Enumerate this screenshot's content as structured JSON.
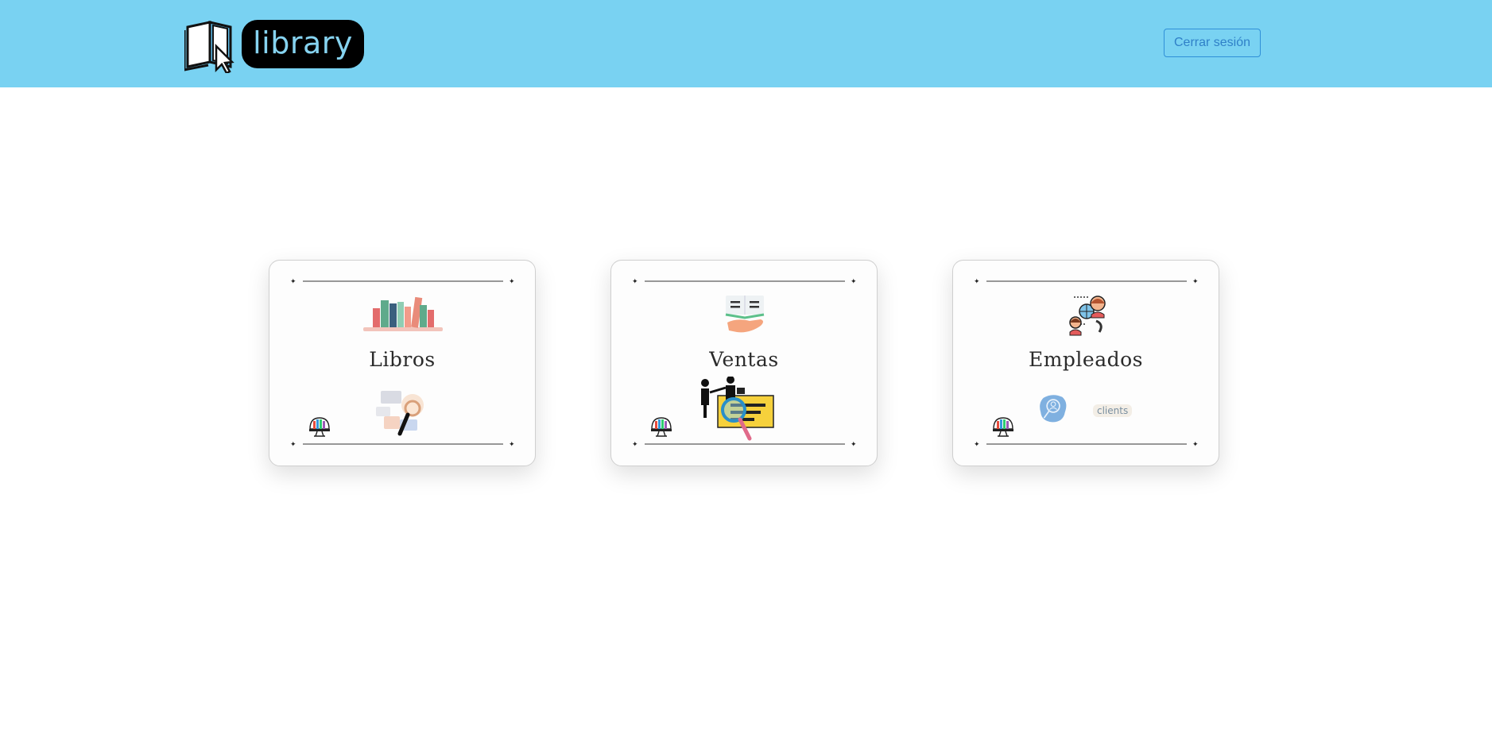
{
  "header": {
    "logo_text": "library",
    "logout_label": "Cerrar sesión",
    "background_color": "#79d2f2",
    "logout_color": "#2f80c8"
  },
  "cards": [
    {
      "title": "Libros",
      "top_icon": "books-shelf-icon",
      "bottom_icon": "book-search-icon",
      "corner_icon": "library-computer-icon"
    },
    {
      "title": "Ventas",
      "top_icon": "hand-book-icon",
      "bottom_icon": "sales-search-icon",
      "corner_icon": "library-computer-icon"
    },
    {
      "title": "Empleados",
      "top_icon": "employees-network-icon",
      "bottom_icon": "clients-search-icon",
      "bottom_label": "clients",
      "corner_icon": "library-computer-icon"
    }
  ]
}
